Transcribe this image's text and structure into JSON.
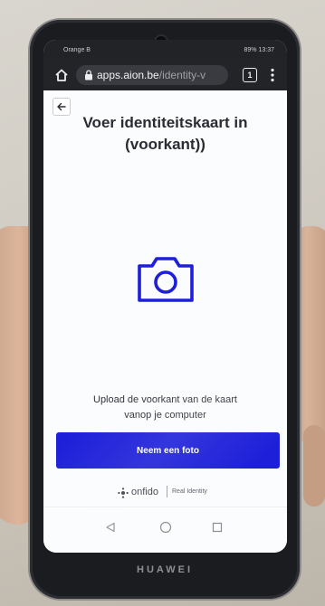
{
  "status_bar": {
    "carrier": "Orange B",
    "battery_time": "89% 13:37"
  },
  "browser": {
    "url_host": "apps.aion.be",
    "url_path": "/identity-v",
    "tab_count": "1"
  },
  "page": {
    "title_line1": "Voer identiteitskaart in",
    "title_line2": "(voorkant))",
    "instructions_line1": "Upload de voorkant van de kaart",
    "instructions_line2": "vanop je computer",
    "photo_button_label": "Neem een foto",
    "accent_color": "#1d1fd9"
  },
  "footer": {
    "brand_name": "onfido",
    "tagline": "Real Identity"
  },
  "device": {
    "brand_label": "HUAWEI"
  },
  "icons": {
    "home": "home-icon",
    "lock": "lock-icon",
    "menu": "more-vert-icon",
    "back": "arrow-left-icon",
    "camera": "camera-icon"
  }
}
